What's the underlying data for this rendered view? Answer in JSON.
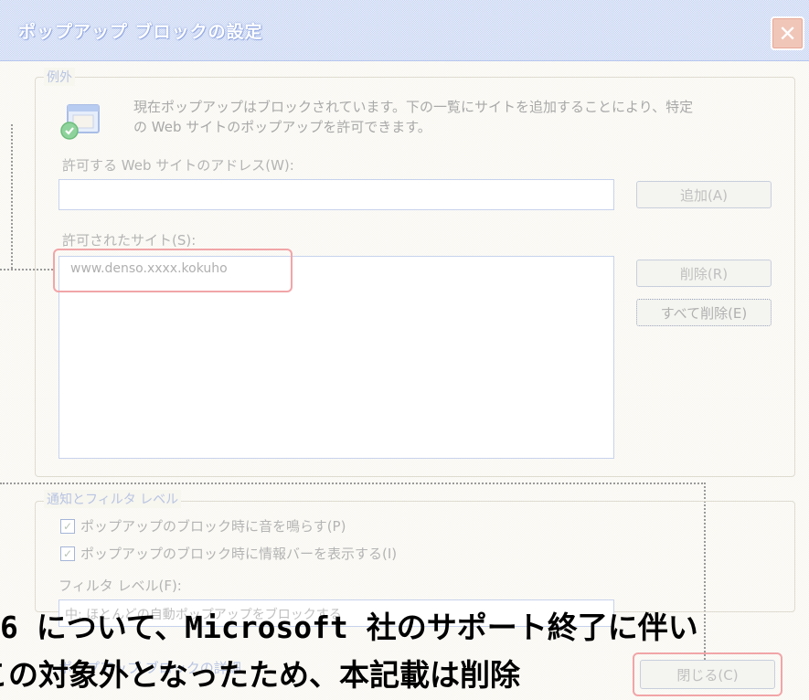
{
  "window": {
    "title": "ポップアップ ブロックの設定",
    "close_glyph": "✕"
  },
  "exceptions": {
    "group_label": "例外",
    "description_line1": "現在ポップアップはブロックされています。下の一覧にサイトを追加することにより、特定",
    "description_line2": "の Web サイトのポップアップを許可できます。",
    "address_label": "許可する Web サイトのアドレス(W):",
    "address_value": "",
    "add_button": "追加(A)",
    "allowed_label": "許可されたサイト(S):",
    "allowed_sites": [
      "www.denso.xxxx.kokuho"
    ],
    "remove_button": "削除(R)",
    "remove_all_button": "すべて削除(E)"
  },
  "notifications": {
    "group_label": "通知とフィルタ レベル",
    "checkbox1_label": "ポップアップのブロック時に音を鳴らす(P)",
    "checkbox1_checked": true,
    "checkbox2_label": "ポップアップのブロック時に情報バーを表示する(I)",
    "checkbox2_checked": true,
    "filter_label": "フィルタ レベル(F):",
    "filter_value": "中: ほとんどの自動ポップアップをブロックする",
    "help_link": "ポップアップ ブロックの詳細",
    "close_button": "閉じる(C)"
  },
  "overlay": {
    "line1": "6 について、Microsoft 社のサポート終了に伴い",
    "line2": "この対象外となったため、本記載は削除"
  },
  "colors": {
    "title_bg": "#c9d6f3",
    "client_bg": "#f7f6ef",
    "highlight_red": "#f1a5a8"
  }
}
